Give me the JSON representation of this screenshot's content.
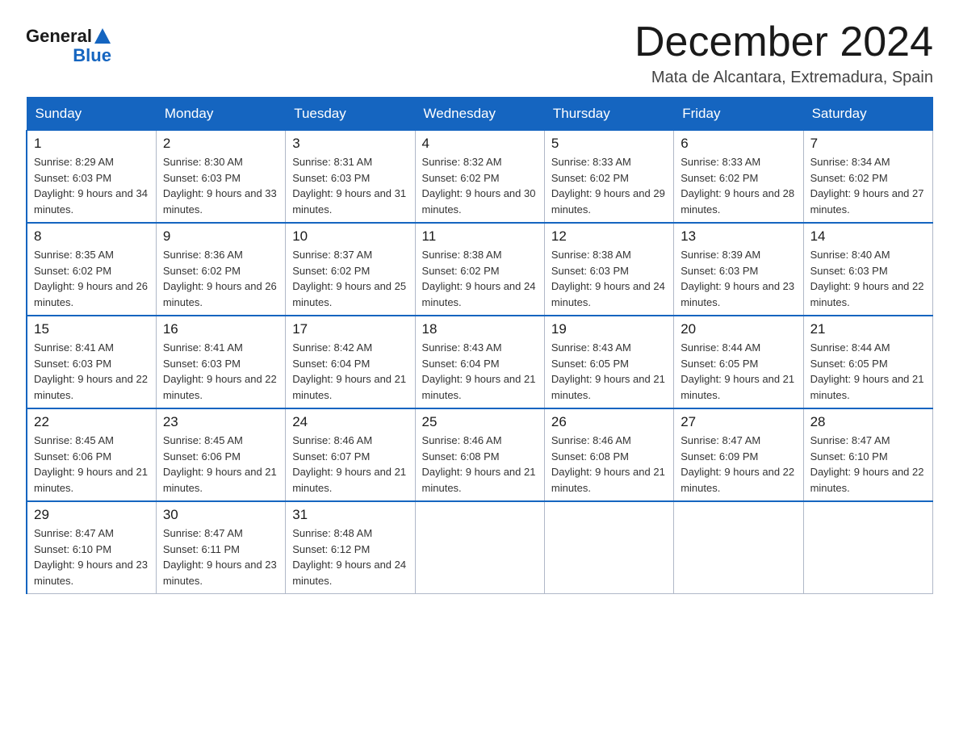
{
  "logo": {
    "text_general": "General",
    "text_blue": "Blue"
  },
  "title": "December 2024",
  "location": "Mata de Alcantara, Extremadura, Spain",
  "days_of_week": [
    "Sunday",
    "Monday",
    "Tuesday",
    "Wednesday",
    "Thursday",
    "Friday",
    "Saturday"
  ],
  "weeks": [
    [
      {
        "day": "1",
        "sunrise": "8:29 AM",
        "sunset": "6:03 PM",
        "daylight": "9 hours and 34 minutes."
      },
      {
        "day": "2",
        "sunrise": "8:30 AM",
        "sunset": "6:03 PM",
        "daylight": "9 hours and 33 minutes."
      },
      {
        "day": "3",
        "sunrise": "8:31 AM",
        "sunset": "6:03 PM",
        "daylight": "9 hours and 31 minutes."
      },
      {
        "day": "4",
        "sunrise": "8:32 AM",
        "sunset": "6:02 PM",
        "daylight": "9 hours and 30 minutes."
      },
      {
        "day": "5",
        "sunrise": "8:33 AM",
        "sunset": "6:02 PM",
        "daylight": "9 hours and 29 minutes."
      },
      {
        "day": "6",
        "sunrise": "8:33 AM",
        "sunset": "6:02 PM",
        "daylight": "9 hours and 28 minutes."
      },
      {
        "day": "7",
        "sunrise": "8:34 AM",
        "sunset": "6:02 PM",
        "daylight": "9 hours and 27 minutes."
      }
    ],
    [
      {
        "day": "8",
        "sunrise": "8:35 AM",
        "sunset": "6:02 PM",
        "daylight": "9 hours and 26 minutes."
      },
      {
        "day": "9",
        "sunrise": "8:36 AM",
        "sunset": "6:02 PM",
        "daylight": "9 hours and 26 minutes."
      },
      {
        "day": "10",
        "sunrise": "8:37 AM",
        "sunset": "6:02 PM",
        "daylight": "9 hours and 25 minutes."
      },
      {
        "day": "11",
        "sunrise": "8:38 AM",
        "sunset": "6:02 PM",
        "daylight": "9 hours and 24 minutes."
      },
      {
        "day": "12",
        "sunrise": "8:38 AM",
        "sunset": "6:03 PM",
        "daylight": "9 hours and 24 minutes."
      },
      {
        "day": "13",
        "sunrise": "8:39 AM",
        "sunset": "6:03 PM",
        "daylight": "9 hours and 23 minutes."
      },
      {
        "day": "14",
        "sunrise": "8:40 AM",
        "sunset": "6:03 PM",
        "daylight": "9 hours and 22 minutes."
      }
    ],
    [
      {
        "day": "15",
        "sunrise": "8:41 AM",
        "sunset": "6:03 PM",
        "daylight": "9 hours and 22 minutes."
      },
      {
        "day": "16",
        "sunrise": "8:41 AM",
        "sunset": "6:03 PM",
        "daylight": "9 hours and 22 minutes."
      },
      {
        "day": "17",
        "sunrise": "8:42 AM",
        "sunset": "6:04 PM",
        "daylight": "9 hours and 21 minutes."
      },
      {
        "day": "18",
        "sunrise": "8:43 AM",
        "sunset": "6:04 PM",
        "daylight": "9 hours and 21 minutes."
      },
      {
        "day": "19",
        "sunrise": "8:43 AM",
        "sunset": "6:05 PM",
        "daylight": "9 hours and 21 minutes."
      },
      {
        "day": "20",
        "sunrise": "8:44 AM",
        "sunset": "6:05 PM",
        "daylight": "9 hours and 21 minutes."
      },
      {
        "day": "21",
        "sunrise": "8:44 AM",
        "sunset": "6:05 PM",
        "daylight": "9 hours and 21 minutes."
      }
    ],
    [
      {
        "day": "22",
        "sunrise": "8:45 AM",
        "sunset": "6:06 PM",
        "daylight": "9 hours and 21 minutes."
      },
      {
        "day": "23",
        "sunrise": "8:45 AM",
        "sunset": "6:06 PM",
        "daylight": "9 hours and 21 minutes."
      },
      {
        "day": "24",
        "sunrise": "8:46 AM",
        "sunset": "6:07 PM",
        "daylight": "9 hours and 21 minutes."
      },
      {
        "day": "25",
        "sunrise": "8:46 AM",
        "sunset": "6:08 PM",
        "daylight": "9 hours and 21 minutes."
      },
      {
        "day": "26",
        "sunrise": "8:46 AM",
        "sunset": "6:08 PM",
        "daylight": "9 hours and 21 minutes."
      },
      {
        "day": "27",
        "sunrise": "8:47 AM",
        "sunset": "6:09 PM",
        "daylight": "9 hours and 22 minutes."
      },
      {
        "day": "28",
        "sunrise": "8:47 AM",
        "sunset": "6:10 PM",
        "daylight": "9 hours and 22 minutes."
      }
    ],
    [
      {
        "day": "29",
        "sunrise": "8:47 AM",
        "sunset": "6:10 PM",
        "daylight": "9 hours and 23 minutes."
      },
      {
        "day": "30",
        "sunrise": "8:47 AM",
        "sunset": "6:11 PM",
        "daylight": "9 hours and 23 minutes."
      },
      {
        "day": "31",
        "sunrise": "8:48 AM",
        "sunset": "6:12 PM",
        "daylight": "9 hours and 24 minutes."
      },
      null,
      null,
      null,
      null
    ]
  ]
}
